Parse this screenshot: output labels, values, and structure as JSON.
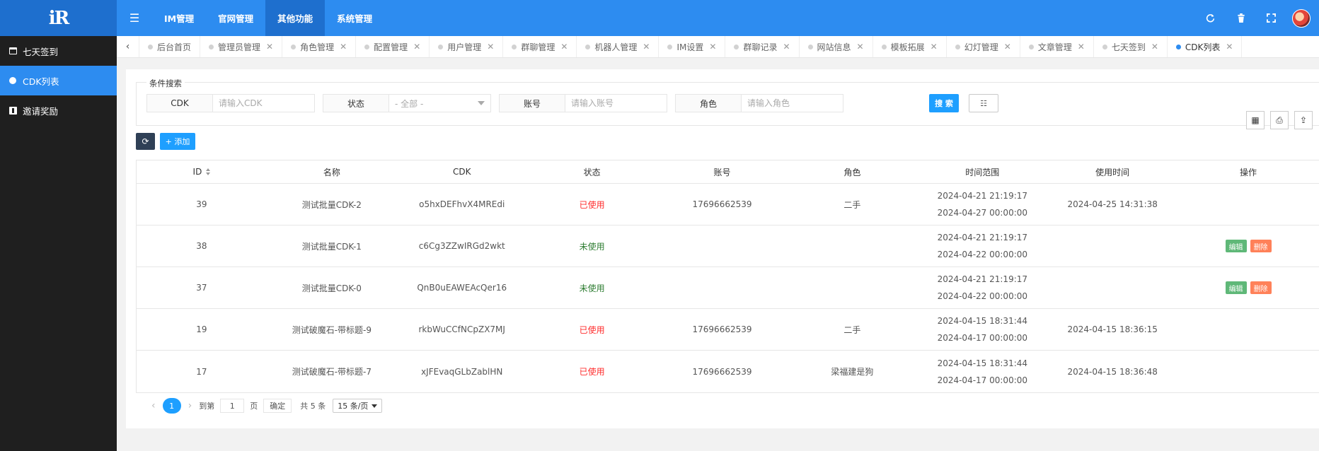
{
  "logo": {
    "text": "iR"
  },
  "sidebar": {
    "items": [
      {
        "label": "七天签到",
        "icon": "calendar-icon",
        "active": false
      },
      {
        "label": "CDK列表",
        "icon": "circle-icon",
        "active": true
      },
      {
        "label": "邀请奖励",
        "icon": "gift-icon",
        "active": false
      }
    ]
  },
  "header": {
    "menu_icon": "☰",
    "nav": [
      {
        "label": "IM管理"
      },
      {
        "label": "官网管理"
      },
      {
        "label": "其他功能"
      },
      {
        "label": "系统管理"
      }
    ]
  },
  "tabs": {
    "items": [
      {
        "label": "后台首页",
        "closable": false
      },
      {
        "label": "管理员管理",
        "closable": true
      },
      {
        "label": "角色管理",
        "closable": true
      },
      {
        "label": "配置管理",
        "closable": true
      },
      {
        "label": "用户管理",
        "closable": true
      },
      {
        "label": "群聊管理",
        "closable": true
      },
      {
        "label": "机器人管理",
        "closable": true
      },
      {
        "label": "IM设置",
        "closable": true
      },
      {
        "label": "群聊记录",
        "closable": true
      },
      {
        "label": "网站信息",
        "closable": true
      },
      {
        "label": "模板拓展",
        "closable": true
      },
      {
        "label": "幻灯管理",
        "closable": true
      },
      {
        "label": "文章管理",
        "closable": true
      },
      {
        "label": "七天签到",
        "closable": true
      },
      {
        "label": "CDK列表",
        "closable": true,
        "active": true
      }
    ]
  },
  "search": {
    "legend": "条件搜索",
    "cdk": {
      "label": "CDK",
      "placeholder": "请输入CDK"
    },
    "status": {
      "label": "状态",
      "value": "- 全部 -"
    },
    "account": {
      "label": "账号",
      "placeholder": "请输入账号"
    },
    "role": {
      "label": "角色",
      "placeholder": "请输入角色"
    },
    "search_btn": "搜 索",
    "collapse_btn": "☷"
  },
  "toolbar": {
    "refresh": "⟳",
    "add": "+ 添加",
    "tools": [
      "▦",
      "⎙",
      "⇪"
    ]
  },
  "table": {
    "columns": [
      "ID",
      "名称",
      "CDK",
      "状态",
      "账号",
      "角色",
      "时间范围",
      "使用时间",
      "操作"
    ],
    "rows": [
      {
        "id": "39",
        "name": "测试批量CDK-2",
        "cdk": "o5hxDEFhvX4MREdi",
        "status": "已使用",
        "status_type": "used",
        "account": "17696662539",
        "role": "二手",
        "start": "2024-04-21 21:19:17",
        "end": "2024-04-27 00:00:00",
        "used_time": "2024-04-25 14:31:38",
        "ops": false
      },
      {
        "id": "38",
        "name": "测试批量CDK-1",
        "cdk": "c6Cg3ZZwIRGd2wkt",
        "status": "未使用",
        "status_type": "unused",
        "account": "",
        "role": "",
        "start": "2024-04-21 21:19:17",
        "end": "2024-04-22 00:00:00",
        "used_time": "",
        "ops": true
      },
      {
        "id": "37",
        "name": "测试批量CDK-0",
        "cdk": "QnB0uEAWEAcQer16",
        "status": "未使用",
        "status_type": "unused",
        "account": "",
        "role": "",
        "start": "2024-04-21 21:19:17",
        "end": "2024-04-22 00:00:00",
        "used_time": "",
        "ops": true
      },
      {
        "id": "19",
        "name": "测试破魔石-带标题-9",
        "cdk": "rkbWuCCfNCpZX7MJ",
        "status": "已使用",
        "status_type": "used",
        "account": "17696662539",
        "role": "二手",
        "start": "2024-04-15 18:31:44",
        "end": "2024-04-17 00:00:00",
        "used_time": "2024-04-15 18:36:15",
        "ops": false
      },
      {
        "id": "17",
        "name": "测试破魔石-带标题-7",
        "cdk": "xJFEvaqGLbZablHN",
        "status": "已使用",
        "status_type": "used",
        "account": "17696662539",
        "role": "梁福建是狗",
        "start": "2024-04-15 18:31:44",
        "end": "2024-04-17 00:00:00",
        "used_time": "2024-04-15 18:36:48",
        "ops": false
      }
    ],
    "edit_label": "编辑",
    "delete_label": "删除"
  },
  "pagination": {
    "current": "1",
    "goto_label": "到第",
    "goto_value": "1",
    "page_label": "页",
    "confirm": "确定",
    "total": "共 5 条",
    "page_size": "15 条/页"
  }
}
